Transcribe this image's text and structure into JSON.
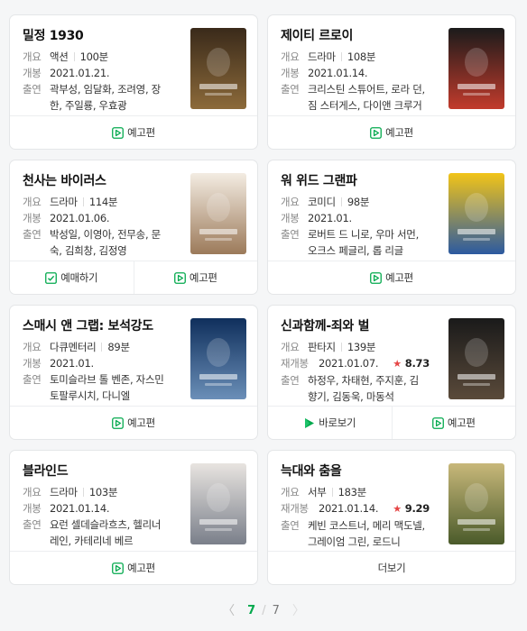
{
  "movies": [
    {
      "title": "밀정 1930",
      "rows": [
        {
          "label": "개요",
          "genre": "액션",
          "runtime": "100분"
        },
        {
          "label": "개봉",
          "date": "2021.01.21."
        },
        {
          "label": "출연",
          "cast": "곽부성, 임달화, 조려영, 장한, 주일룡, 우효광"
        }
      ],
      "actions": [
        {
          "label": "예고편",
          "icon": "play-outline-icon"
        }
      ],
      "poster_colors": [
        "#3a2a1a",
        "#8c6a3a"
      ]
    },
    {
      "title": "제이티 르로이",
      "rows": [
        {
          "label": "개요",
          "genre": "드라마",
          "runtime": "108분"
        },
        {
          "label": "개봉",
          "date": "2021.01.14."
        },
        {
          "label": "출연",
          "cast": "크리스틴 스튜어트, 로라 던, 짐 스터게스, 다이앤 크루거"
        }
      ],
      "actions": [
        {
          "label": "예고편",
          "icon": "play-outline-icon"
        }
      ],
      "poster_colors": [
        "#1b1b1b",
        "#c23b2c"
      ]
    },
    {
      "title": "천사는 바이러스",
      "rows": [
        {
          "label": "개요",
          "genre": "드라마",
          "runtime": "114분"
        },
        {
          "label": "개봉",
          "date": "2021.01.06."
        },
        {
          "label": "출연",
          "cast": "박성일, 이영아, 전무송, 문숙, 김희창, 김정영"
        }
      ],
      "actions": [
        {
          "label": "예매하기",
          "icon": "ticket-check-icon"
        },
        {
          "label": "예고편",
          "icon": "play-outline-icon"
        }
      ],
      "poster_colors": [
        "#f3ece2",
        "#9c7a5a"
      ]
    },
    {
      "title": "워 위드 그랜파",
      "rows": [
        {
          "label": "개요",
          "genre": "코미디",
          "runtime": "98분"
        },
        {
          "label": "개봉",
          "date": "2021.01."
        },
        {
          "label": "출연",
          "cast": "로버트 드 니로, 우마 서먼, 오크스 페글리, 롭 리글"
        }
      ],
      "actions": [
        {
          "label": "예고편",
          "icon": "play-outline-icon"
        }
      ],
      "poster_colors": [
        "#f2c418",
        "#2c5aa0"
      ]
    },
    {
      "title": "스매시 앤 그랩: 보석강도",
      "rows": [
        {
          "label": "개요",
          "genre": "다큐멘터리",
          "runtime": "89분"
        },
        {
          "label": "개봉",
          "date": "2021.01."
        },
        {
          "label": "출연",
          "cast": "토미슬라브 톨 벤존, 자스민 토팔루시치, 다니엘"
        }
      ],
      "actions": [
        {
          "label": "예고편",
          "icon": "play-outline-icon"
        }
      ],
      "poster_colors": [
        "#0f2f5c",
        "#6b8fb8"
      ]
    },
    {
      "title": "신과함께-죄와 벌",
      "rows": [
        {
          "label": "개요",
          "genre": "판타지",
          "runtime": "139분"
        },
        {
          "label": "재개봉",
          "date": "2021.01.07.",
          "rating": "8.73"
        },
        {
          "label": "출연",
          "cast": "하정우, 차태현, 주지훈, 김향기, 김동욱, 마동석"
        }
      ],
      "actions": [
        {
          "label": "바로보기",
          "icon": "play-filled-icon"
        },
        {
          "label": "예고편",
          "icon": "play-outline-icon"
        }
      ],
      "poster_colors": [
        "#1a1a1a",
        "#5a4a3a"
      ]
    },
    {
      "title": "블라인드",
      "rows": [
        {
          "label": "개요",
          "genre": "드라마",
          "runtime": "103분"
        },
        {
          "label": "개봉",
          "date": "2021.01.14."
        },
        {
          "label": "출연",
          "cast": "요런 셀데슬라흐츠, 헬리너 레인, 카테리네 베르"
        }
      ],
      "actions": [
        {
          "label": "예고편",
          "icon": "play-outline-icon"
        }
      ],
      "poster_colors": [
        "#e8e4e0",
        "#7a7f8a"
      ]
    },
    {
      "title": "늑대와 춤을",
      "rows": [
        {
          "label": "개요",
          "genre": "서부",
          "runtime": "183분"
        },
        {
          "label": "재개봉",
          "date": "2021.01.14.",
          "rating": "9.29"
        },
        {
          "label": "출연",
          "cast": "케빈 코스트너, 메리 맥도넬, 그레이엄 그린, 로드니"
        }
      ],
      "actions": [
        {
          "label": "더보기",
          "icon": ""
        }
      ],
      "poster_colors": [
        "#c8b87a",
        "#4a5a2a"
      ]
    }
  ],
  "pagination": {
    "prev": "〈",
    "current": "7",
    "separator": "/",
    "total": "7",
    "next": "〉"
  },
  "colors": {
    "accent_green": "#03a94d",
    "star_red": "#e54545"
  }
}
